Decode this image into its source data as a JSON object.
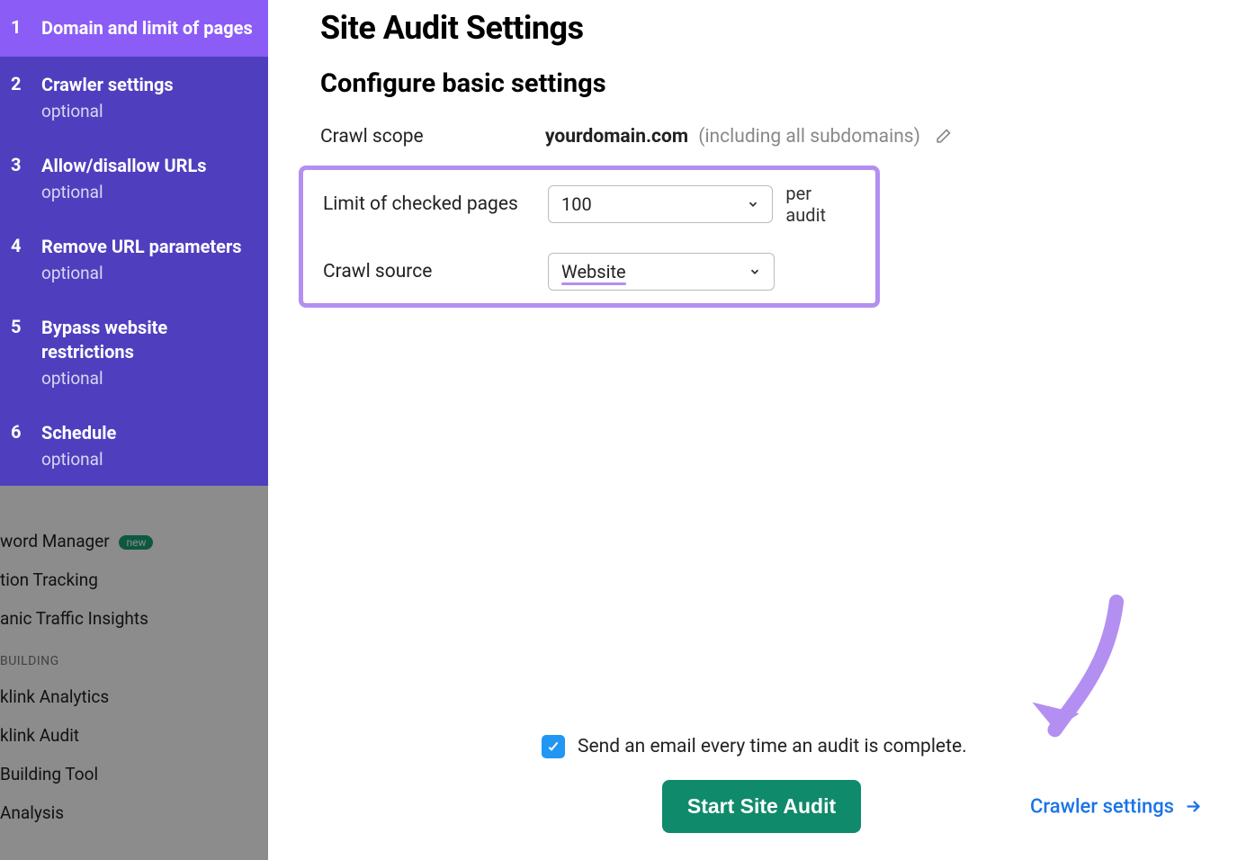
{
  "page": {
    "title": "Site Audit Settings",
    "section_title": "Configure basic settings"
  },
  "wizard_steps": [
    {
      "num": "1",
      "title": "Domain and limit of pages",
      "optional": ""
    },
    {
      "num": "2",
      "title": "Crawler settings",
      "optional": "optional"
    },
    {
      "num": "3",
      "title": "Allow/disallow URLs",
      "optional": "optional"
    },
    {
      "num": "4",
      "title": "Remove URL parameters",
      "optional": "optional"
    },
    {
      "num": "5",
      "title": "Bypass website restrictions",
      "optional": "optional"
    },
    {
      "num": "6",
      "title": "Schedule",
      "optional": "optional"
    }
  ],
  "fields": {
    "crawl_scope_label": "Crawl scope",
    "crawl_scope_domain": "yourdomain.com",
    "crawl_scope_suffix": "(including all subdomains)",
    "limit_label": "Limit of checked pages",
    "limit_value": "100",
    "limit_suffix": "per audit",
    "crawl_source_label": "Crawl source",
    "crawl_source_value": "Website"
  },
  "footer": {
    "email_label": "Send an email every time an audit is complete.",
    "start_button": "Start Site Audit",
    "next_link": "Crawler settings"
  },
  "bg_menu": {
    "kw_manager": "word Manager",
    "kw_manager_badge": "new",
    "pos_tracking": "tion Tracking",
    "traffic": "anic Traffic Insights",
    "section_label": "BUILDING",
    "bl_analytics": "klink Analytics",
    "bl_audit": "klink Audit",
    "bl_tool": " Building Tool",
    "analysis": " Analysis"
  }
}
